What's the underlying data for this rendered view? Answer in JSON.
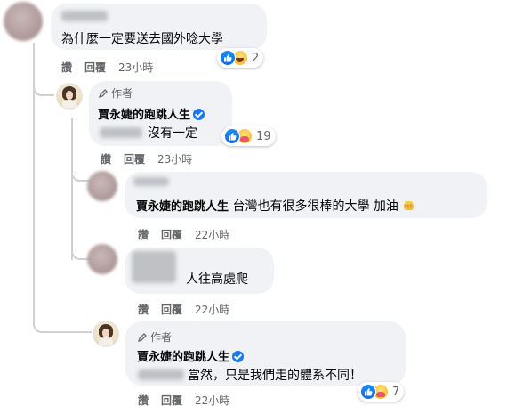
{
  "comments": [
    {
      "id": "c1",
      "text": "為什麼一定要送去國外唸大學",
      "actions": {
        "like": "讚",
        "reply": "回覆",
        "time": "23小時"
      },
      "reactions": {
        "types": [
          "like-icon",
          "haha-icon"
        ],
        "count": "2"
      }
    },
    {
      "id": "c2",
      "author_tag": "作者",
      "author_name": "賈永婕的跑跳人生",
      "text": "沒有一定",
      "actions": {
        "like": "讚",
        "reply": "回覆",
        "time": "23小時"
      },
      "reactions": {
        "types": [
          "like-icon",
          "care-icon"
        ],
        "count": "19"
      }
    },
    {
      "id": "c3",
      "author_name": "賈永婕的跑跳人生",
      "text": "台灣也有很多很棒的大學 加油",
      "actions": {
        "like": "讚",
        "reply": "回覆",
        "time": "22小時"
      }
    },
    {
      "id": "c4",
      "text": "人往高處爬",
      "actions": {
        "like": "讚",
        "reply": "回覆",
        "time": "22小時"
      }
    },
    {
      "id": "c5",
      "author_tag": "作者",
      "author_name": "賈永婕的跑跳人生",
      "text": "當然，只是我們走的體系不同！",
      "actions": {
        "like": "讚",
        "reply": "回覆",
        "time": "22小時"
      },
      "reactions": {
        "types": [
          "like-icon",
          "care-icon"
        ],
        "count": "7"
      }
    }
  ],
  "colors": {
    "bubble": "#f0f2f5",
    "secondary_text": "#65676b",
    "like_blue": "#1877f2",
    "thread_line": "#ced0d4"
  }
}
